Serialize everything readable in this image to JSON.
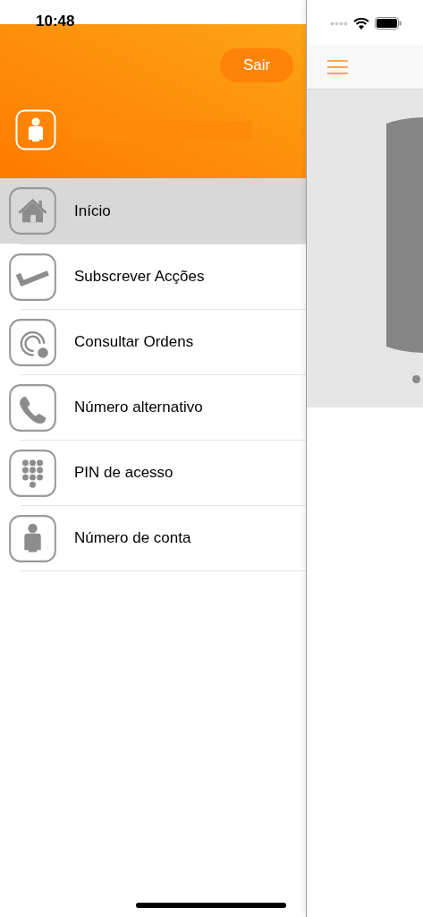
{
  "status_bar": {
    "time": "10:48"
  },
  "drawer": {
    "logout_button": "Sair",
    "menu": [
      {
        "kind": "home",
        "label": "Início",
        "selected": true
      },
      {
        "kind": "check",
        "label": "Subscrever Acções",
        "selected": false
      },
      {
        "kind": "target",
        "label": "Consultar Ordens",
        "selected": false
      },
      {
        "kind": "phone",
        "label": "Número alternativo",
        "selected": false
      },
      {
        "kind": "keypad",
        "label": "PIN de acesso",
        "selected": false
      },
      {
        "kind": "person",
        "label": "Número de conta",
        "selected": false
      }
    ]
  }
}
